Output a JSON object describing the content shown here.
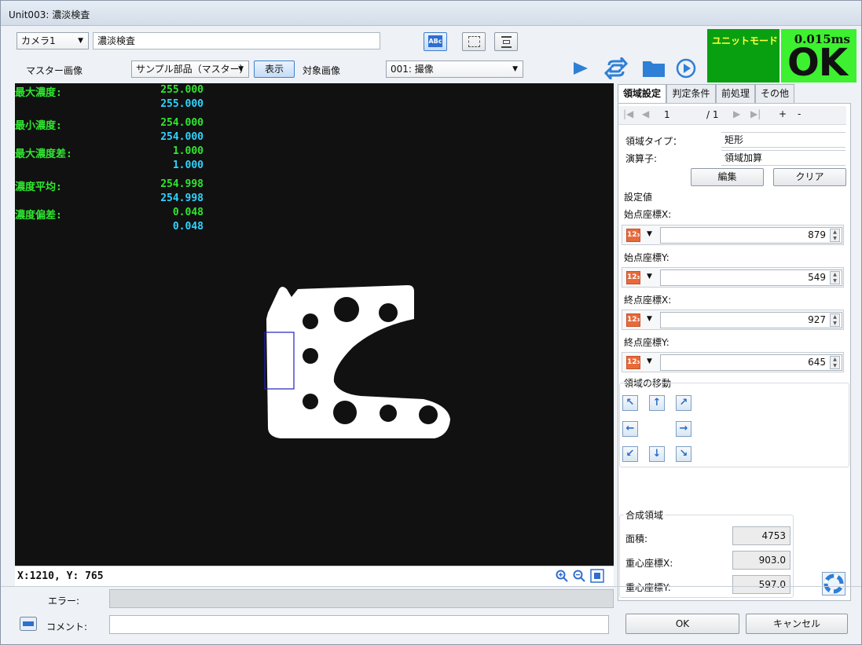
{
  "window": {
    "title": "Unit003: 濃淡検査"
  },
  "toolbar": {
    "camera": "カメラ1",
    "inspection_name": "濃淡検査",
    "master_label": "マスター画像",
    "master_select": "サンプル部品（マスター）",
    "show_button": "表示",
    "target_label": "対象画像",
    "target_select": "001: 撮像",
    "abc_icon_text": "ABc"
  },
  "status": {
    "mode": "ユニットモード",
    "time": "0.015ms",
    "result": "OK"
  },
  "measurements": [
    {
      "label": "最大濃度:",
      "value1": "255.000",
      "value2": "255.000"
    },
    {
      "label": "最小濃度:",
      "value1": "254.000",
      "value2": "254.000"
    },
    {
      "label": "最大濃度差:",
      "value1": "1.000",
      "value2": "1.000"
    },
    {
      "label": "濃度平均:",
      "value1": "254.998",
      "value2": "254.998"
    },
    {
      "label": "濃度偏差:",
      "value1": "0.048",
      "value2": "0.048"
    }
  ],
  "viewer": {
    "coords": "X:1210, Y: 765"
  },
  "tabs": [
    "領域設定",
    "判定条件",
    "前処理",
    "その他"
  ],
  "region": {
    "page_current": "1",
    "page_total": "/ 1",
    "plus": "+",
    "minus": "-",
    "type_label": "領域タイプ：",
    "type_value": "矩形",
    "operator_label": "演算子:",
    "operator_value": "領域加算",
    "edit_button": "編集",
    "clear_button": "クリア",
    "settings_title": "設定値",
    "fields": [
      {
        "label": "始点座標X:",
        "value": "879"
      },
      {
        "label": "始点座標Y:",
        "value": "549"
      },
      {
        "label": "終点座標X:",
        "value": "927"
      },
      {
        "label": "終点座標Y:",
        "value": "645"
      }
    ],
    "numeric_icon_text": "12₃",
    "move_title": "領域の移動"
  },
  "composite": {
    "title": "合成領域",
    "area_label": "面積:",
    "area_value": "4753",
    "cx_label": "重心座標X:",
    "cx_value": "903.0",
    "cy_label": "重心座標Y:",
    "cy_value": "597.0"
  },
  "footer": {
    "error_label": "エラー:",
    "comment_label": "コメント:",
    "ok_button": "OK",
    "cancel_button": "キャンセル"
  }
}
